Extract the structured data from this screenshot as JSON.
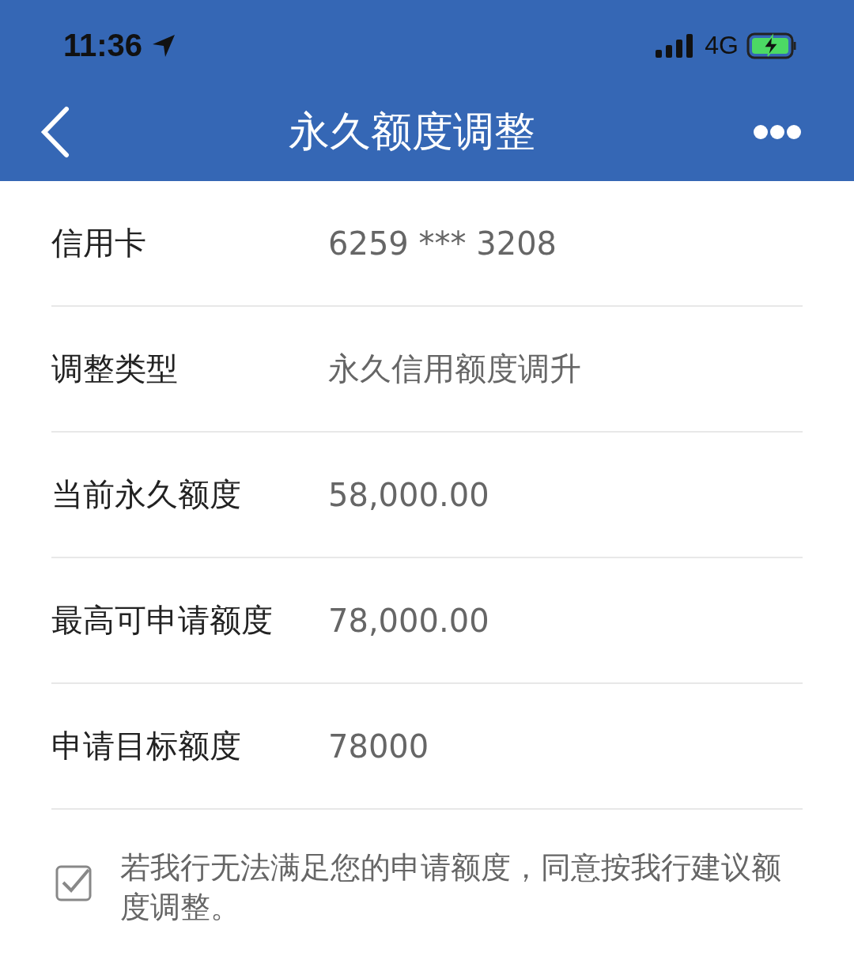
{
  "status_bar": {
    "time": "11:36",
    "network": "4G"
  },
  "nav": {
    "title": "永久额度调整"
  },
  "rows": [
    {
      "label": "信用卡",
      "value": "6259 *** 3208"
    },
    {
      "label": "调整类型",
      "value": "永久信用额度调升"
    },
    {
      "label": "当前永久额度",
      "value": "58,000.00"
    },
    {
      "label": "最高可申请额度",
      "value": "78,000.00"
    },
    {
      "label": "申请目标额度",
      "value": "78000"
    }
  ],
  "agreement": {
    "checked": true,
    "text": "若我行无法满足您的申请额度，同意按我行建议额度调整。"
  }
}
